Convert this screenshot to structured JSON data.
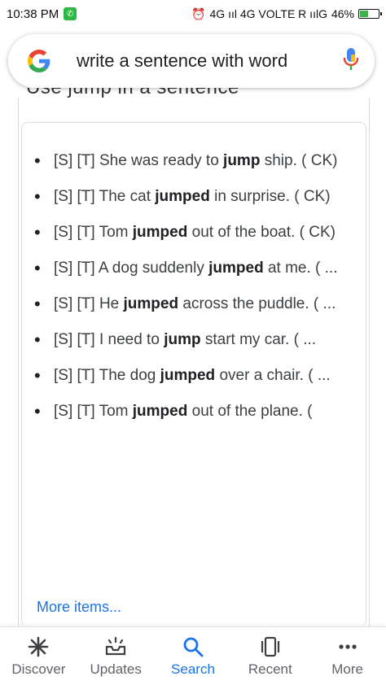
{
  "status": {
    "time": "10:38 PM",
    "network": "4G ııl 4G VOLTE R ıılG",
    "battery": "46%",
    "battery_level": 0.46
  },
  "search": {
    "query": "write a sentence with word"
  },
  "section": {
    "heading_cut": "Use jump in a sentence"
  },
  "sentences": [
    {
      "prefix": "[S] [T] She was ready to ",
      "bold": "jump",
      "suffix": " ship. ( CK)"
    },
    {
      "prefix": "[S] [T] The cat ",
      "bold": "jumped",
      "suffix": " in surprise. ( CK)"
    },
    {
      "prefix": "[S] [T] Tom ",
      "bold": "jumped",
      "suffix": " out of the boat. ( CK)"
    },
    {
      "prefix": "[S] [T] A dog suddenly ",
      "bold": "jumped",
      "suffix": " at me. ( ..."
    },
    {
      "prefix": "[S] [T] He ",
      "bold": "jumped",
      "suffix": " across the puddle. ( ..."
    },
    {
      "prefix": "[S] [T] I need to ",
      "bold": "jump",
      "suffix": " start my car. ( ..."
    },
    {
      "prefix": "[S] [T] The dog ",
      "bold": "jumped",
      "suffix": " over a chair. ( ..."
    },
    {
      "prefix": "[S] [T] Tom ",
      "bold": "jumped",
      "suffix": " out of the plane. ("
    }
  ],
  "more_items": "More items...",
  "nav": [
    {
      "label": "Discover",
      "icon": "asterisk-icon"
    },
    {
      "label": "Updates",
      "icon": "inbox-icon"
    },
    {
      "label": "Search",
      "icon": "search-icon"
    },
    {
      "label": "Recent",
      "icon": "tabs-icon"
    },
    {
      "label": "More",
      "icon": "more-dots-icon"
    }
  ],
  "colors": {
    "accent": "#1a73e8",
    "battery": "#3bb54a",
    "whatsapp": "#2bb741"
  }
}
